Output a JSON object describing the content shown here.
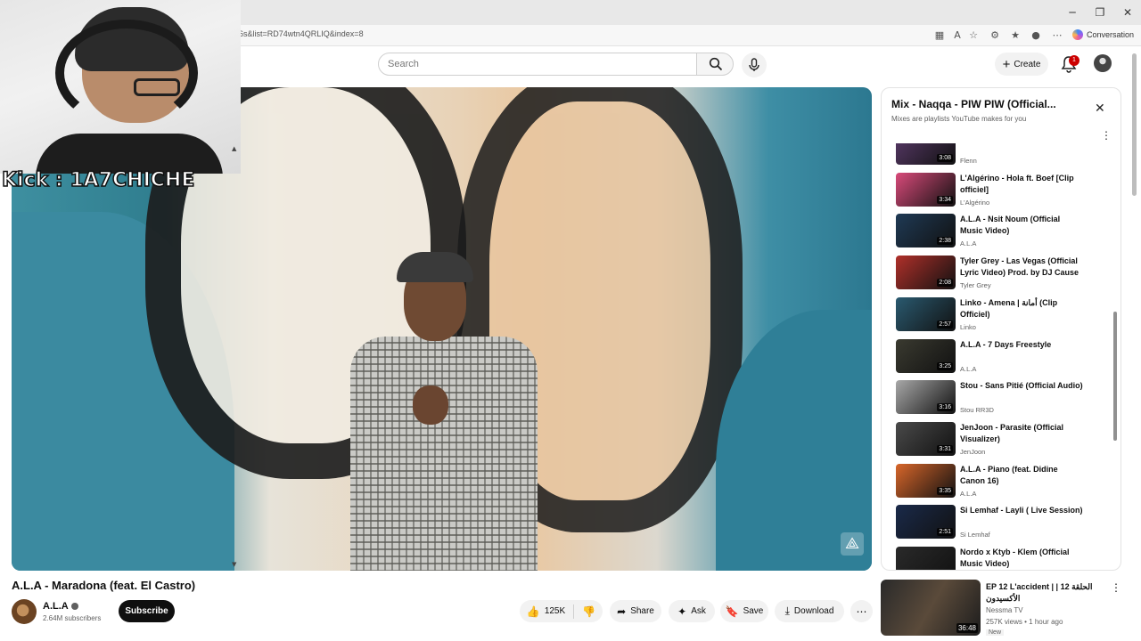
{
  "browser": {
    "url": "6s&list=RD74wtn4QRLIQ&index=8",
    "conversation_label": "Conversation",
    "window_controls": [
      "minimize-icon",
      "maximize-icon",
      "close-icon"
    ]
  },
  "topbar": {
    "search_placeholder": "Search",
    "create_label": "Create",
    "notification_count": "1"
  },
  "overlay": {
    "kick_label": "Kick : 1A7CHICHE"
  },
  "video": {
    "title": "A.L.A - Maradona (feat. El Castro)",
    "channel": "A.L.A",
    "subscribers": "2.64M subscribers",
    "subscribe_label": "Subscribe",
    "likes": "125K",
    "share_label": "Share",
    "ask_label": "Ask",
    "save_label": "Save",
    "download_label": "Download"
  },
  "playlist": {
    "title": "Mix - Naqqa - PIW PIW (Official...",
    "subtitle": "Mixes are playlists YouTube makes for you",
    "items": [
      {
        "title": "",
        "channel": "Flenn",
        "duration": "3:08",
        "color": "#5a3a6a"
      },
      {
        "title": "L'Algérino - Hola ft. Boef [Clip officiel]",
        "channel": "L'Algérino",
        "duration": "3:34",
        "color": "#d94a7a"
      },
      {
        "title": "A.L.A - Nsit Noum (Official Music Video)",
        "channel": "A.L.A",
        "duration": "2:38",
        "color": "#1f3a55"
      },
      {
        "title": "Tyler Grey - Las Vegas (Official Lyric Video) Prod. by DJ Cause",
        "channel": "Tyler Grey",
        "duration": "2:08",
        "color": "#b0302a"
      },
      {
        "title": "Linko - Amena | أمانة (Clip Officiel)",
        "channel": "Linko",
        "duration": "2:57",
        "color": "#2a5a70"
      },
      {
        "title": "A.L.A - 7 Days Freestyle",
        "channel": "A.L.A",
        "duration": "3:25",
        "color": "#3a3a30"
      },
      {
        "title": "Stou - Sans Pitié (Official Audio)",
        "channel": "Stou RR3D",
        "duration": "3:16",
        "color": "#a8a8a8"
      },
      {
        "title": "JenJoon - Parasite (Official Visualizer)",
        "channel": "JenJoon",
        "duration": "3:31",
        "color": "#4a4a4a"
      },
      {
        "title": "A.L.A - Piano (feat. Didine Canon 16)",
        "channel": "A.L.A",
        "duration": "3:35",
        "color": "#d8662a"
      },
      {
        "title": "Si Lemhaf - Layli ( Live Session)",
        "channel": "Si Lemhaf",
        "duration": "2:51",
        "color": "#1a2a4a"
      },
      {
        "title": "Nordo x Ktyb - Klem (Official Music Video)",
        "channel": "",
        "duration": "",
        "color": "#2a2a2a"
      }
    ]
  },
  "next_video": {
    "title": "EP 12 L'accident | الحلقة 12 | الأكسيدون",
    "channel": "Nessma TV",
    "meta": "257K views • 1 hour ago",
    "badge": "New",
    "duration": "36:48"
  }
}
